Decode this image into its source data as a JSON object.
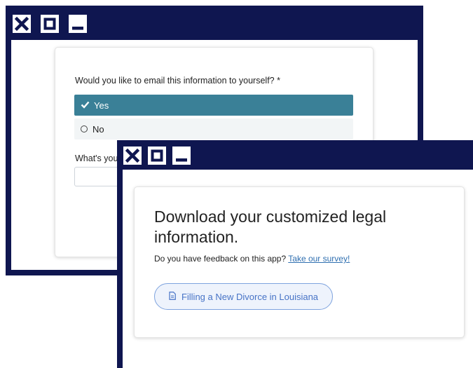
{
  "colors": {
    "frame": "#0f1650",
    "selected_option": "#3a8097",
    "button_border": "#7ea3de",
    "button_text": "#4773c6",
    "link": "#2f6fb0"
  },
  "back_window": {
    "titlebar_icons": [
      "close-icon",
      "maximize-icon",
      "minimize-icon"
    ],
    "email_question": "Would you like to email this information to yourself? *",
    "options": [
      {
        "label": "Yes",
        "selected": true,
        "icon": "check-icon"
      },
      {
        "label": "No",
        "selected": false,
        "icon": "radio-icon"
      }
    ],
    "second_question_partial": "What's you"
  },
  "front_window": {
    "titlebar_icons": [
      "close-icon",
      "maximize-icon",
      "minimize-icon"
    ],
    "heading": "Download your customized legal information.",
    "feedback_text": "Do you have feedback on this app?",
    "survey_link": "Take our survey!",
    "download_button": {
      "icon": "document-icon",
      "label": "Filling a New Divorce in Louisiana"
    }
  }
}
